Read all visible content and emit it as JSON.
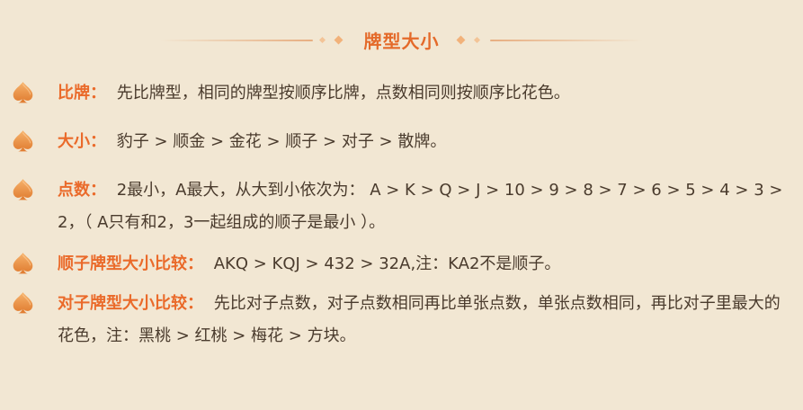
{
  "header": {
    "title": "牌型大小"
  },
  "items": [
    {
      "label": "比牌：",
      "content": "先比牌型，相同的牌型按顺序比牌，点数相同则按顺序比花色。"
    },
    {
      "label": "大小：",
      "content": "豹子 > 顺金 > 金花 > 顺子 > 对子 > 散牌。"
    },
    {
      "label": "点数：",
      "content": "2最小，A最大，从大到小依次为： A > K > Q > J > 10 > 9 > 8 > 7 > 6 > 5 > 4 > 3 > 2，（ A只有和2，3一起组成的顺子是最小 ）。"
    },
    {
      "label": "顺子牌型大小比较：",
      "content": "AKQ > KQJ > 432 > 32A,注：KA2不是顺子。"
    },
    {
      "label": "对子牌型大小比较：",
      "content": "先比对子点数，对子点数相同再比单张点数，单张点数相同，再比对子里最大的花色，注：黑桃 > 红桃 > 梅花 > 方块。"
    }
  ],
  "colors": {
    "background": "#f2e7d3",
    "accent": "#ea6a2a",
    "text": "#4a3b2d",
    "icon": "spade-icon"
  }
}
